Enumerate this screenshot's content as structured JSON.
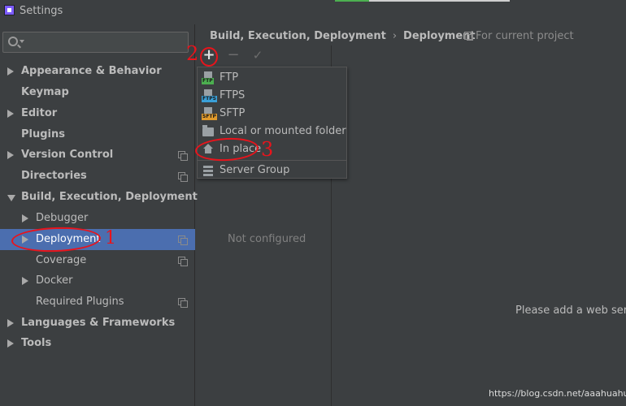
{
  "window": {
    "title": "Settings"
  },
  "search": {
    "value": "",
    "placeholder": ""
  },
  "sidebar": {
    "items": [
      {
        "label": "Appearance & Behavior"
      },
      {
        "label": "Keymap"
      },
      {
        "label": "Editor"
      },
      {
        "label": "Plugins"
      },
      {
        "label": "Version Control"
      },
      {
        "label": "Directories"
      },
      {
        "label": "Build, Execution, Deployment"
      },
      {
        "label": "Debugger"
      },
      {
        "label": "Deployment"
      },
      {
        "label": "Coverage"
      },
      {
        "label": "Docker"
      },
      {
        "label": "Required Plugins"
      },
      {
        "label": "Languages & Frameworks"
      },
      {
        "label": "Tools"
      }
    ],
    "selected": "Deployment"
  },
  "breadcrumb": {
    "parent": "Build, Execution, Deployment",
    "current": "Deployment",
    "scope_label": "For current project"
  },
  "toolbar": {
    "add_glyph": "+",
    "remove_glyph": "−",
    "apply_glyph": "✓"
  },
  "popup": {
    "items": [
      {
        "label": "FTP",
        "icon": "ftp-icon",
        "tag": "FTP",
        "tag_color": "#4caf50"
      },
      {
        "label": "FTPS",
        "icon": "ftps-icon",
        "tag": "FTPS",
        "tag_color": "#3aa0d8"
      },
      {
        "label": "SFTP",
        "icon": "sftp-icon",
        "tag": "SFTP",
        "tag_color": "#e09a2c"
      },
      {
        "label": "Local or mounted folder",
        "icon": "folder-icon"
      },
      {
        "label": "In place",
        "icon": "house-icon"
      },
      {
        "label": "Server Group",
        "icon": "server-group-icon"
      }
    ]
  },
  "middle": {
    "empty_text": "Not configured"
  },
  "main": {
    "hint": "Please add a web server"
  },
  "watermark": "https://blog.csdn.net/aaahuahua",
  "annotations": {
    "mark_1": "1",
    "mark_2": "2",
    "mark_3": "3",
    "color": "#e8141c"
  },
  "colors": {
    "background": "#3c3f41",
    "selection": "#4b6eaf",
    "text": "#bbbbbb"
  }
}
